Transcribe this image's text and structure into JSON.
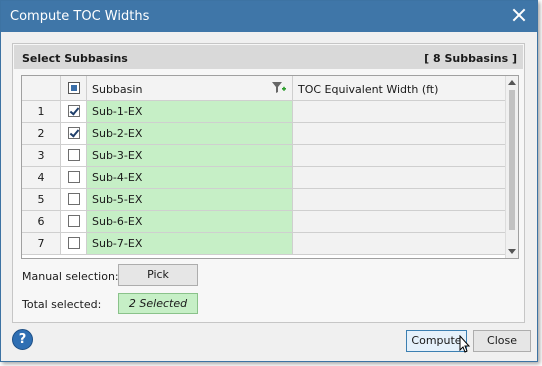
{
  "window": {
    "title": "Compute TOC Widths"
  },
  "group": {
    "title": "Select Subbasins",
    "count_label": "[ 8 Subbasins ]"
  },
  "grid": {
    "columns": [
      "Subbasin",
      "TOC Equivalent Width (ft)"
    ],
    "rows": [
      {
        "num": "1",
        "name": "Sub-1-EX",
        "checked": true
      },
      {
        "num": "2",
        "name": "Sub-2-EX",
        "checked": true
      },
      {
        "num": "3",
        "name": "Sub-3-EX",
        "checked": false
      },
      {
        "num": "4",
        "name": "Sub-4-EX",
        "checked": false
      },
      {
        "num": "5",
        "name": "Sub-5-EX",
        "checked": false
      },
      {
        "num": "6",
        "name": "Sub-6-EX",
        "checked": false
      },
      {
        "num": "7",
        "name": "Sub-7-EX",
        "checked": false
      }
    ]
  },
  "manual_selection": {
    "label": "Manual selection:",
    "button": "Pick"
  },
  "total_selected": {
    "label": "Total selected:",
    "value": "2 Selected"
  },
  "footer": {
    "help": "?",
    "compute": "Compute",
    "close": "Close"
  },
  "icons": {
    "title_close": "close-icon",
    "filter": "filter-add-icon",
    "help": "help-icon"
  },
  "colors": {
    "titlebar": "#3f76a8",
    "subbasin_cell": "#c6efc6",
    "accent": "#3a6ea8"
  }
}
